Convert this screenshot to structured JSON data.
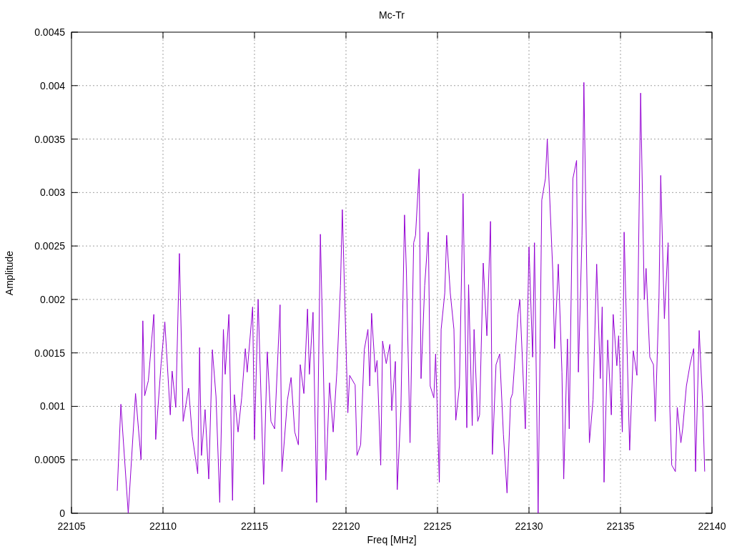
{
  "chart_data": {
    "type": "line",
    "title": "Mc-Tr",
    "xlabel": "Freq [MHz]",
    "ylabel": "Amplitude",
    "xlim": [
      22105,
      22140
    ],
    "ylim": [
      0,
      0.0045
    ],
    "grid": true,
    "xticks": [
      22105,
      22110,
      22115,
      22120,
      22125,
      22130,
      22135,
      22140
    ],
    "yticks": [
      0,
      0.0005,
      0.001,
      0.0015,
      0.002,
      0.0025,
      0.003,
      0.0035,
      0.004,
      0.0045
    ],
    "x": [
      22107.5,
      22107.7,
      22108.1,
      22108.5,
      22108.8,
      22108.9,
      22109.0,
      22109.2,
      22109.5,
      22109.6,
      22109.9,
      22110.1,
      22110.4,
      22110.5,
      22110.7,
      22110.9,
      22111.1,
      22111.4,
      22111.6,
      22111.9,
      22112.0,
      22112.1,
      22112.3,
      22112.5,
      22112.7,
      22112.9,
      22113.1,
      22113.3,
      22113.4,
      22113.6,
      22113.8,
      22113.9,
      22114.1,
      22114.3,
      22114.5,
      22114.6,
      22114.9,
      22115.0,
      22115.2,
      22115.5,
      22115.7,
      22115.9,
      22116.1,
      22116.4,
      22116.5,
      22116.8,
      22117.0,
      22117.2,
      22117.4,
      22117.5,
      22117.7,
      22117.9,
      22118.0,
      22118.2,
      22118.4,
      22118.6,
      22118.9,
      22119.1,
      22119.3,
      22119.5,
      22119.7,
      22119.8,
      22120.1,
      22120.2,
      22120.5,
      22120.6,
      22120.8,
      22121.0,
      22121.2,
      22121.3,
      22121.4,
      22121.6,
      22121.7,
      22121.9,
      22122.0,
      22122.2,
      22122.4,
      22122.5,
      22122.7,
      22122.8,
      22123.0,
      22123.2,
      22123.3,
      22123.5,
      22123.7,
      22123.8,
      22124.0,
      22124.1,
      22124.3,
      22124.5,
      22124.6,
      22124.8,
      22124.9,
      22125.1,
      22125.2,
      22125.4,
      22125.5,
      22125.7,
      22125.9,
      22126.0,
      22126.2,
      22126.4,
      22126.6,
      22126.7,
      22126.9,
      22127.0,
      22127.2,
      22127.3,
      22127.5,
      22127.7,
      22127.9,
      22128.0,
      22128.2,
      22128.4,
      22128.6,
      22128.8,
      22129.0,
      22129.1,
      22129.4,
      22129.5,
      22129.8,
      22130.0,
      22130.2,
      22130.3,
      22130.5,
      22130.7,
      22130.9,
      22131.0,
      22131.3,
      22131.4,
      22131.6,
      22131.8,
      22131.9,
      22132.1,
      22132.2,
      22132.4,
      22132.6,
      22132.7,
      22132.9,
      22133.0,
      22133.3,
      22133.5,
      22133.7,
      22133.9,
      22134.0,
      22134.1,
      22134.3,
      22134.5,
      22134.6,
      22134.8,
      22134.9,
      22135.1,
      22135.2,
      22135.5,
      22135.7,
      22135.9,
      22136.1,
      22136.3,
      22136.4,
      22136.6,
      22136.8,
      22136.9,
      22137.1,
      22137.2,
      22137.4,
      22137.6,
      22137.7,
      22137.8,
      22138.0,
      22138.1,
      22138.3,
      22138.4,
      22138.6,
      22138.8,
      22139.0,
      22139.1,
      22139.3,
      22139.5,
      22139.6
    ],
    "series": [
      {
        "color": "#9400d3",
        "values": [
          0.00021,
          0.00102,
          0,
          0.00112,
          0.0005,
          0.0018,
          0.0011,
          0.00124,
          0.00186,
          0.00069,
          0.0014,
          0.00179,
          0.00092,
          0.00133,
          0.00099,
          0.00243,
          0.00086,
          0.00117,
          0.00072,
          0.00037,
          0.00155,
          0.00054,
          0.00097,
          0.00032,
          0.00153,
          0.00109,
          0.0001,
          0.00172,
          0.0013,
          0.00186,
          0.00012,
          0.00111,
          0.00076,
          0.00108,
          0.00154,
          0.00132,
          0.00193,
          0.00069,
          0.002,
          0.00027,
          0.00151,
          0.00086,
          0.00079,
          0.00195,
          0.00039,
          0.00106,
          0.00127,
          0.00076,
          0.00064,
          0.00139,
          0.00112,
          0.00191,
          0.0013,
          0.00188,
          0.0001,
          0.00261,
          0.00031,
          0.00122,
          0.00076,
          0.00132,
          0.00213,
          0.00284,
          0.00094,
          0.00129,
          0.0012,
          0.00054,
          0.00064,
          0.00153,
          0.00172,
          0.00119,
          0.00187,
          0.00132,
          0.00143,
          0.00045,
          0.00161,
          0.0014,
          0.00158,
          0.00096,
          0.00142,
          0.00022,
          0.00097,
          0.00279,
          0.00226,
          0.00066,
          0.00253,
          0.0026,
          0.00322,
          0.00126,
          0.00213,
          0.00263,
          0.00119,
          0.00108,
          0.00149,
          0.00029,
          0.00172,
          0.00206,
          0.0026,
          0.00206,
          0.00172,
          0.00087,
          0.00119,
          0.00299,
          0.0008,
          0.00214,
          0.00082,
          0.00172,
          0.00086,
          0.00092,
          0.00234,
          0.00166,
          0.00273,
          0.00055,
          0.00139,
          0.00149,
          0.00074,
          0.00019,
          0.00107,
          0.00112,
          0.00186,
          0.002,
          0.00079,
          0.00249,
          0.00146,
          0.00253,
          0,
          0.00293,
          0.00313,
          0.0035,
          0.00226,
          0.00154,
          0.00233,
          0.00132,
          0.00032,
          0.00163,
          0.00079,
          0.00313,
          0.0033,
          0.00132,
          0.0026,
          0.00403,
          0.00066,
          0.00106,
          0.00233,
          0.00126,
          0.00193,
          0.00029,
          0.00162,
          0.00092,
          0.00186,
          0.00138,
          0.00166,
          0.00076,
          0.00263,
          0.00059,
          0.00152,
          0.00129,
          0.00393,
          0.002,
          0.00229,
          0.00146,
          0.00139,
          0.00086,
          0.002,
          0.00316,
          0.00182,
          0.00253,
          0.00097,
          0.00045,
          0.00039,
          0.00099,
          0.00066,
          0.00079,
          0.00119,
          0.00139,
          0.00154,
          0.00039,
          0.00171,
          0.00099,
          0.00039
        ]
      }
    ]
  }
}
